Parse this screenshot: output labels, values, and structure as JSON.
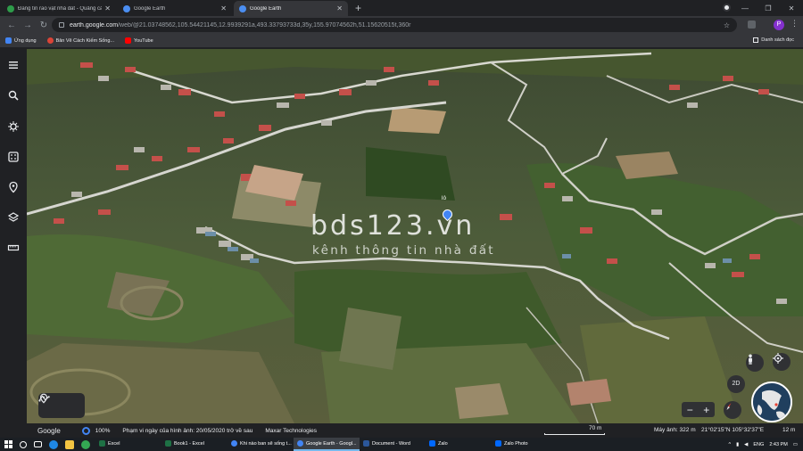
{
  "browser": {
    "tabs": [
      {
        "label": "Đăng tin rao vặt nhà đất - Quảng cáo n",
        "favicon_color": "#2e9c4a",
        "active": false
      },
      {
        "label": "Google Earth",
        "favicon_color": "#4b8ef1",
        "active": false
      },
      {
        "label": "Google Earth",
        "favicon_color": "#4b8ef1",
        "active": true
      }
    ],
    "new_tab": "+",
    "window_controls": {
      "minimize": "—",
      "restore": "❐",
      "close": "✕"
    },
    "url_main": "earth.google.com",
    "url_rest": "/web/@21.03748562,105.54421145,12.9939291a,493.33793733d,35y,155.97074562h,51.15620515t,360r",
    "profile_letter": "P"
  },
  "bookmarks": {
    "items": [
      {
        "label": "Ứng dụng",
        "color": "#4285f4"
      },
      {
        "label": "Bản Vẽ Cách Kiếm Sống...",
        "color": "#db4437"
      },
      {
        "label": "YouTube",
        "color": "#ff0000"
      }
    ],
    "other": "Danh sách đọc"
  },
  "sidebar": {
    "icons": [
      "menu-icon",
      "search-icon",
      "voyager-icon",
      "dice-icon",
      "projects-icon",
      "layers-icon",
      "measure-icon"
    ]
  },
  "map": {
    "watermark_title": "bds123.vn",
    "watermark_subtitle": "kênh thông tin nhà đất",
    "pin_label": "lô",
    "btn_2d": "2D",
    "zoom_out": "−",
    "zoom_in": "+"
  },
  "statusbar": {
    "brand": "Google",
    "percent": "100%",
    "imagery": "Phạm vi ngày của hình ảnh: 20/05/2020 trở về sau",
    "provider": "Maxar Technologies",
    "scale": "70 m",
    "camera": "Máy ảnh: 322 m",
    "coordinates": "21°02'15\"N 105°32'37\"E",
    "elevation": "12 m"
  },
  "taskbar": {
    "apps": [
      {
        "label": "Excel",
        "color": "#1e7145",
        "active": false
      },
      {
        "label": "Book1 - Excel",
        "color": "#1e7145",
        "active": false
      },
      {
        "label": "Khi nào ban sẽ sống t...",
        "color": "#4285f4",
        "active": false
      },
      {
        "label": "Google Earth - Googl...",
        "color": "#4285f4",
        "active": true
      },
      {
        "label": "Document - Word",
        "color": "#2b579a",
        "active": false
      },
      {
        "label": "Zalo",
        "color": "#0068ff",
        "active": false
      },
      {
        "label": "Zalo Photo",
        "color": "#0068ff",
        "active": false
      }
    ],
    "lang": "ENG",
    "time": "2:43 PM"
  }
}
